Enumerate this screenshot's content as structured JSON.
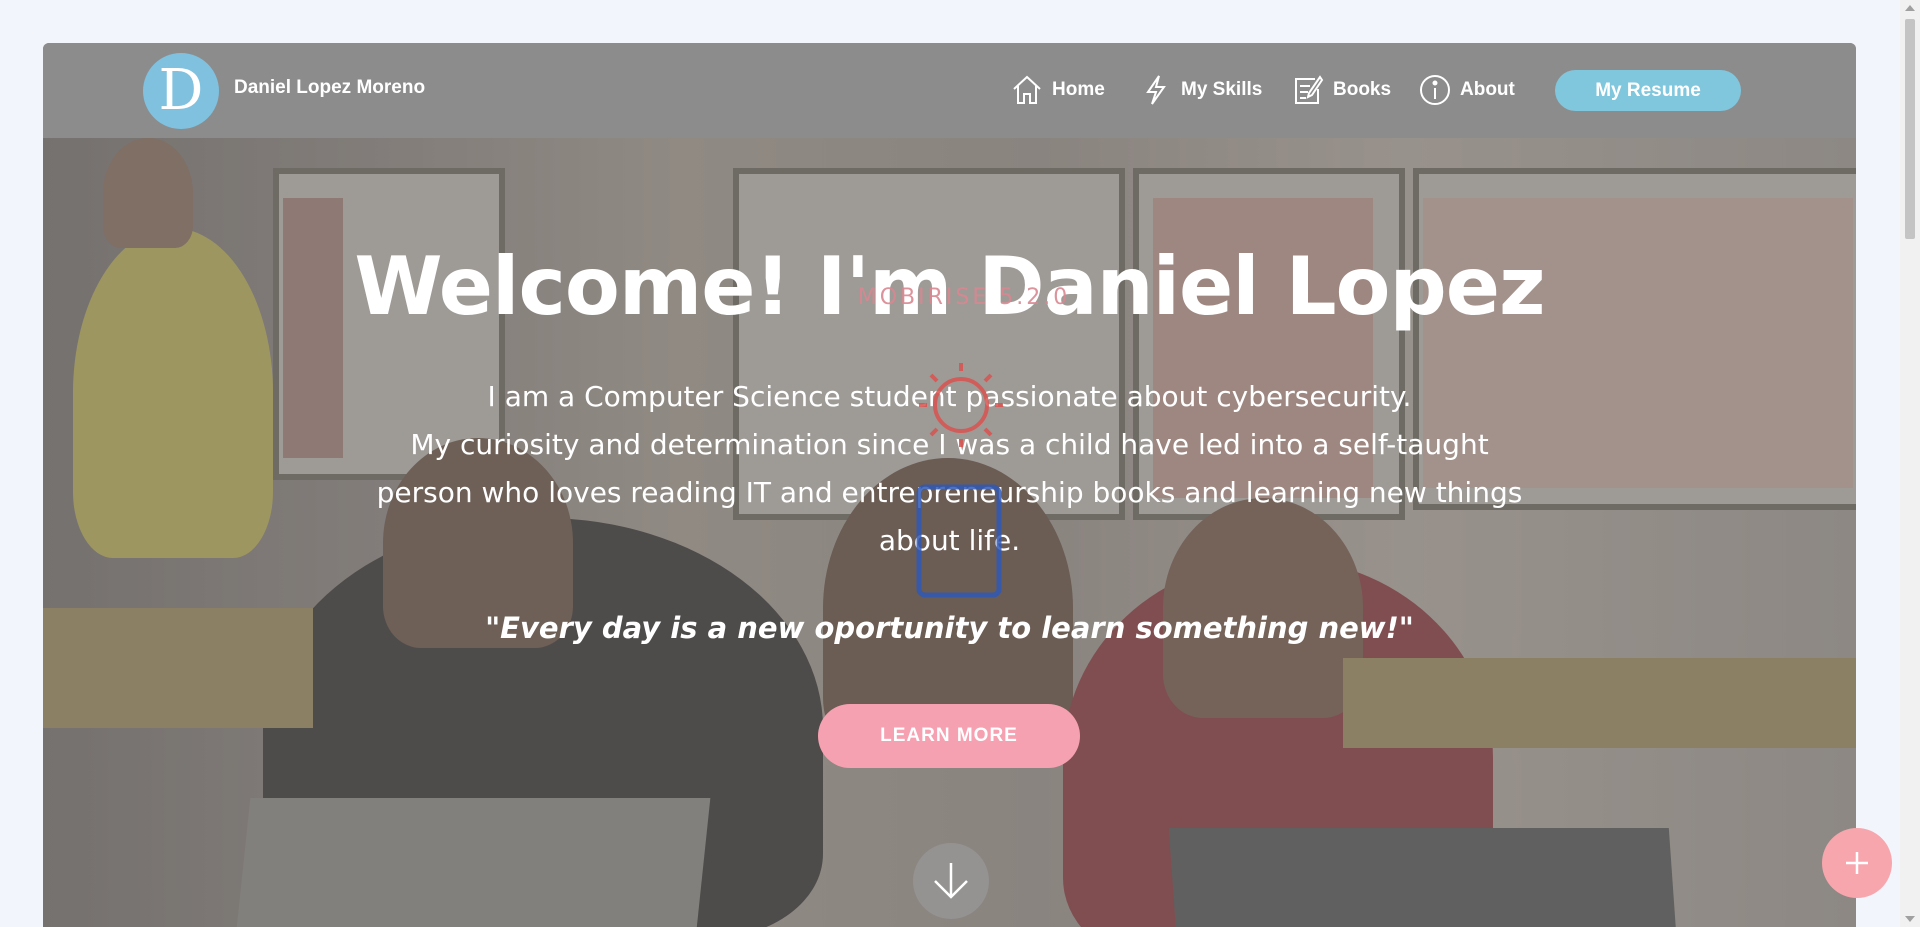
{
  "brand": {
    "logo_letter": "D",
    "name": "Daniel Lopez Moreno"
  },
  "nav": {
    "items": [
      {
        "label": "Home",
        "icon": "home-icon"
      },
      {
        "label": "My Skills",
        "icon": "lightning-icon"
      },
      {
        "label": "Books",
        "icon": "edit-icon"
      },
      {
        "label": "About",
        "icon": "info-icon"
      }
    ],
    "resume_label": "My Resume"
  },
  "hero": {
    "title": "Welcome! I'm Daniel Lopez",
    "text_lines": [
      "I am a Computer Science student passionate about cybersecurity.",
      "My curiosity and determination since I was a child have led into a self-taught",
      "person who loves reading IT and entrepreneurship books and learning new things",
      "about life."
    ],
    "quote": "\"Every day is a new oportunity to learn something new!\"",
    "cta_label": "LEARN MORE"
  },
  "watermark": {
    "text": "MOBIRISE 5.2.0"
  },
  "colors": {
    "accent_pink": "#f6a1b1",
    "accent_blue": "#80c6dd",
    "navbar": "#8c8c8c"
  }
}
